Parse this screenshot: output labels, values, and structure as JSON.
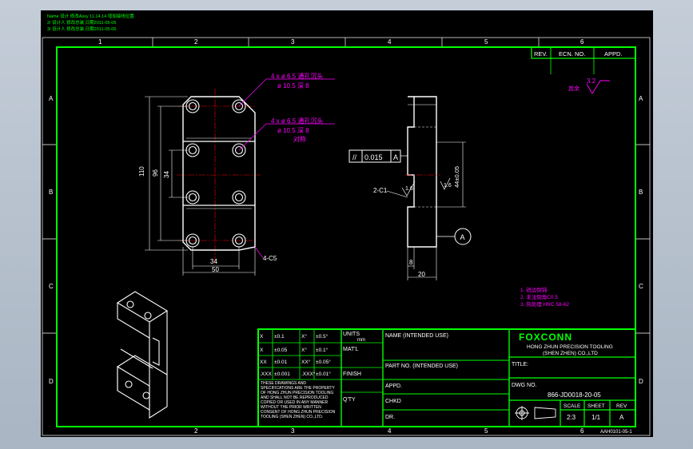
{
  "notes": {
    "line1": "Name 设计 修改Assy 11.14.14 增加接线位置",
    "line2": "2/ 设计人 修改总装 日期2011-05-05",
    "line3": "3/ 设计人 修改总装 日期2011-05-05"
  },
  "zones": {
    "columns": [
      "1",
      "2",
      "3",
      "4",
      "5",
      "6"
    ],
    "rows": [
      "A",
      "B",
      "C",
      "D"
    ]
  },
  "revision": {
    "rev": "REV.",
    "ecn": "ECN. NO.",
    "appd": "APPD."
  },
  "surface": {
    "roughness": "3.2",
    "mark": "其余"
  },
  "views": {
    "front": {
      "hole_callout_1": "4 x ø 6.5 通孔沉头",
      "hole_callout_1b": "ø 10.5 深 8",
      "hole_callout_2": "4 x ø 6.5 通孔沉头",
      "hole_callout_2b": "ø 10.5 深 8",
      "hole_callout_2c": "对称",
      "dim_110": "110",
      "dim_96": "96",
      "dim_34_vert": "34",
      "dim_34_horiz": "34",
      "dim_50": "50",
      "chamfer": "4-C5"
    },
    "side": {
      "tolerance_symbol": "//",
      "tolerance_value": "0.015",
      "datum": "A",
      "dim_vertical": "44±0.05",
      "chamfer": "2-C1",
      "roughness_left": "1.6",
      "roughness_right": "1.6",
      "dim_8": "8",
      "dim_20": "20",
      "datum_label": "A"
    }
  },
  "tech_notes": {
    "line1": "1. 锐边倒钝",
    "line2": "2. 未注倒角C0.5",
    "line3": "3. 热处理 HRC 58-62"
  },
  "title_block": {
    "tolerances": [
      [
        "X",
        "±0.1",
        "X°",
        "±0.5°"
      ],
      [
        "X",
        "±0.05",
        "X°",
        "±0.1°"
      ],
      [
        "XX",
        "±0.01",
        "XX°",
        "±0.05°"
      ],
      [
        ".XXX",
        "±0.001",
        ".XXX°",
        "±0.01°"
      ]
    ],
    "units": "UNITS",
    "units_value": "mm",
    "matl": "MAT'L",
    "finish": "FINISH",
    "qty": "Q'TY",
    "disclaimer": "THESE DRAWINGS AND SPECIFICATIONS ARE THE PROPERTY OF HONG ZHUN PRECISION TOOLING AND SHALL NOT BE REPRODUCED COPIED OR USED IN ANY MANNER WITHOUT THE PRIOR WRITTEN CONSENT OF HONG ZHUN PRECISION TOOLING (SHEN ZHEN) CO.,LTD.",
    "name_label": "NAME (INTENDED USE)",
    "part_no_label": "PART NO. (INTENDED USE)",
    "appd": "APPD.",
    "chkd": "CHKD",
    "dr": "DR.",
    "company_logo": "FOXCONN",
    "company_line1": "HONG ZHUN PRECISION TOOLING",
    "company_line2": "(SHEN ZHEN) CO.,LTD",
    "title_label": "TITLE:",
    "dwg_no_label": "DWG NO.",
    "dwg_no": "866-JD0018-20-05",
    "scale_label": "SCALE",
    "scale": "2:3",
    "sheet_label": "SHEET",
    "sheet": "1/1",
    "rev_label": "REV",
    "rev": "A"
  },
  "form_no": "AAH0101-05-1"
}
